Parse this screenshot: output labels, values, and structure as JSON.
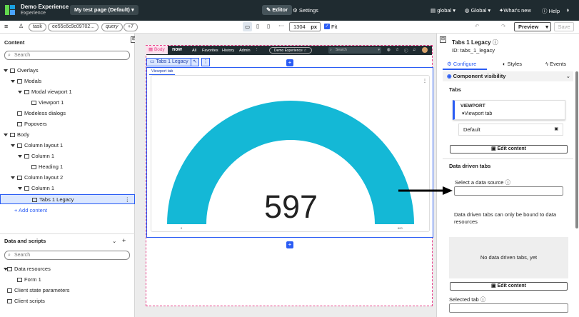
{
  "app": {
    "name": "Demo Experience",
    "subname": "Experience",
    "page_selector": "My test page (Default)"
  },
  "topnav": {
    "editor": "Editor",
    "settings": "Settings",
    "scope1": "global",
    "scope2": "Global",
    "whats_new": "What's new",
    "help": "Help"
  },
  "toolbar": {
    "tags": [
      "task",
      "ee55c6c9c09702...",
      "query",
      "+7"
    ],
    "width_value": "1304",
    "width_unit": "px",
    "fit": "Fit",
    "preview": "Preview",
    "save": "Save"
  },
  "left": {
    "content_title": "Content",
    "search_placeholder": "Search",
    "tree": [
      {
        "label": "Overlays",
        "level": 0,
        "expanded": true,
        "selected": false
      },
      {
        "label": "Modals",
        "level": 1,
        "expanded": true,
        "selected": false
      },
      {
        "label": "Modal viewport 1",
        "level": 2,
        "expanded": true,
        "selected": false
      },
      {
        "label": "Viewport 1",
        "level": 3,
        "expanded": false,
        "selected": false
      },
      {
        "label": "Modeless dialogs",
        "level": 1,
        "expanded": false,
        "selected": false
      },
      {
        "label": "Popovers",
        "level": 1,
        "expanded": false,
        "selected": false
      },
      {
        "label": "Body",
        "level": 0,
        "expanded": true,
        "selected": false
      },
      {
        "label": "Column layout 1",
        "level": 1,
        "expanded": true,
        "selected": false
      },
      {
        "label": "Column 1",
        "level": 2,
        "expanded": true,
        "selected": false
      },
      {
        "label": "Heading 1",
        "level": 3,
        "expanded": false,
        "selected": false
      },
      {
        "label": "Column layout 2",
        "level": 1,
        "expanded": true,
        "selected": false
      },
      {
        "label": "Column 1",
        "level": 2,
        "expanded": true,
        "selected": false
      },
      {
        "label": "Tabs 1 Legacy",
        "level": 3,
        "expanded": false,
        "selected": true
      }
    ],
    "add_content": "+ Add content",
    "data_title": "Data and scripts",
    "data_search_placeholder": "Search",
    "data_tree": [
      {
        "label": "Data resources",
        "level": 0
      },
      {
        "label": "Form 1",
        "level": 1
      },
      {
        "label": "Client state parameters",
        "level": 0
      },
      {
        "label": "Client scripts",
        "level": 0
      }
    ]
  },
  "canvas": {
    "body_tag": "Body",
    "logo": "now",
    "nav": [
      "All",
      "Favorites",
      "History",
      "Admin"
    ],
    "experience_pill": "Demo Experience ☆",
    "nav_search": "Search",
    "selected_tag": "Tabs 1 Legacy",
    "tab_label": "Viewport tab",
    "gauge_value": "597",
    "gauge_fraction": 1.0,
    "gauge_min_label": "0",
    "gauge_max_label": "600",
    "gauge_color": "#14b8d6"
  },
  "right": {
    "title": "Tabs 1 Legacy",
    "id_label": "ID: tabs_1_legacy",
    "tabs": [
      "Configure",
      "Styles",
      "Events"
    ],
    "visibility": "Component visibility",
    "tabs_section": "Tabs",
    "viewport_label": "VIEWPORT",
    "viewport_tab": "Viewport tab",
    "default_label": "Default",
    "edit_content": "Edit content",
    "data_driven_title": "Data driven tabs",
    "select_source": "Select a data source",
    "data_driven_note": "Data driven tabs can only be bound to data resources",
    "no_tabs": "No data driven tabs, yet",
    "edit_content2": "Edit content",
    "selected_tab": "Selected tab"
  },
  "colors": {
    "topbar": "#1f2b30",
    "accent": "#2a5cf4",
    "selection": "#dbe7ff",
    "body_pink": "#e8418a"
  }
}
